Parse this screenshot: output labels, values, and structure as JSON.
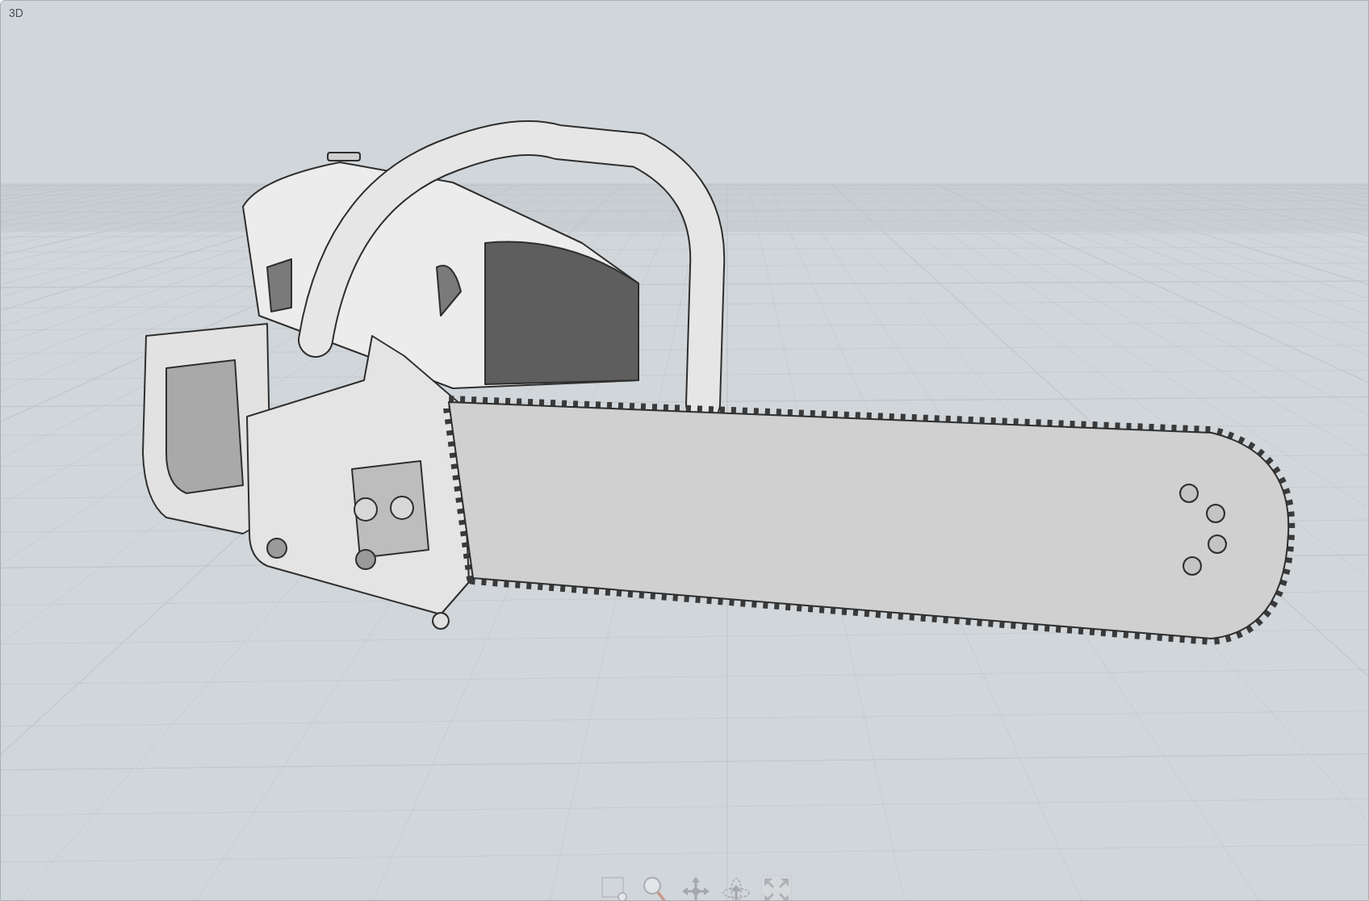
{
  "viewport": {
    "label": "3D"
  }
}
